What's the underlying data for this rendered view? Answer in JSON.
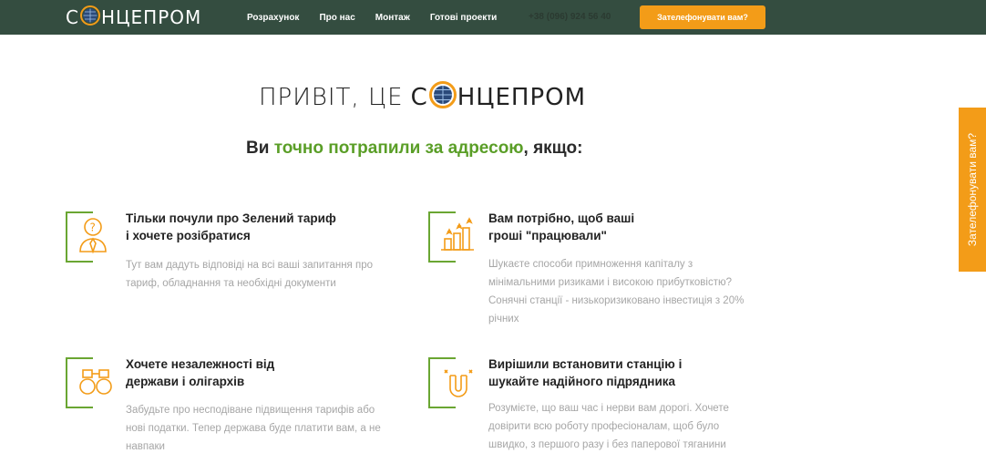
{
  "header": {
    "logo_before": "С",
    "logo_after": "НЦЕПРОМ",
    "nav": [
      "Розрахунок",
      "Про нас",
      "Монтаж",
      "Готові проекти"
    ],
    "phone": "+38 (096) 924 56 40",
    "cta_label": "Зателефонувати вам?"
  },
  "side_tab_label": "Зателефонувати вам?",
  "hero": {
    "greeting": "ПРИВІТ, ЦЕ",
    "brand_before": "С",
    "brand_after": "НЦЕПРОМ"
  },
  "subtitle": {
    "lead": "Ви",
    "highlight": "точно потрапили за адресою",
    "tail": ", якщо:"
  },
  "cards": [
    {
      "icon": "question-person-icon",
      "title1": "Тільки почули про Зелений тариф",
      "title2": "і хочете розібратися",
      "text1": "Тут вам дадуть відповіді на всі ваші запитання про",
      "text2": "тариф, обладнання та необхідні документи",
      "text3": "",
      "text4": ""
    },
    {
      "icon": "growth-chart-icon",
      "title1": "Вам потрібно, щоб ваші",
      "title2": "гроші \"працювали\"",
      "text1": "Шукаєте способи примноження капіталу з",
      "text2": "мінімальними ризиками і високою прибутковістю?",
      "text3": "Сонячні станції - низькоризиковано інвестиція з 20%",
      "text4": "річних"
    },
    {
      "icon": "handcuffs-icon",
      "title1": "Хочете незалежності від",
      "title2": "держави і олігархів",
      "text1": "Забудьте про несподіване підвищення тарифів або",
      "text2": "нові податки. Тепер держава буде платити вам, а не",
      "text3": "навпаки",
      "text4": ""
    },
    {
      "icon": "magnet-icon",
      "title1": "Вирішили встановити станцію і",
      "title2": "шукайте надійного підрядника",
      "text1": "Розумієте, що ваш час і нерви вам дорогі. Хочете",
      "text2": "довірити всю роботу професіоналам, щоб було",
      "text3": "швидко, з першого разу і без паперової тяганини",
      "text4": ""
    }
  ]
}
